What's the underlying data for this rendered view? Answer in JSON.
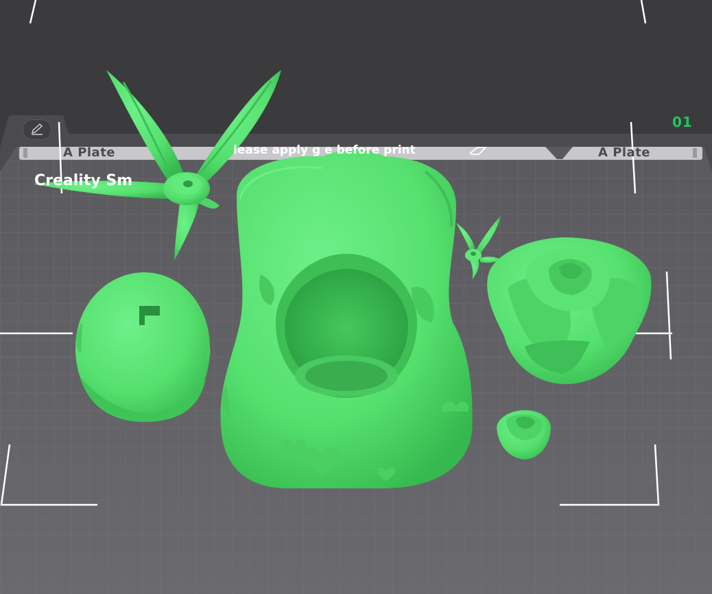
{
  "plate": {
    "number": "01",
    "label_left": "A Plate",
    "label_right": "A Plate",
    "name": "Creality Sm",
    "notice": "lease apply g  e before print"
  },
  "colors": {
    "background": "#3b3b3e",
    "bed": "#5f5f63",
    "grid": "#8a8a8e",
    "model": "#55e06e",
    "model_shadow": "#2fb34a",
    "plate_number": "#22c55e"
  },
  "icons": {
    "edit": "pencil-icon",
    "notice": "eraser-icon"
  },
  "models": [
    "flower-star",
    "egg",
    "bulbasaur-planter",
    "small-flower",
    "rose-large",
    "rose-small"
  ]
}
